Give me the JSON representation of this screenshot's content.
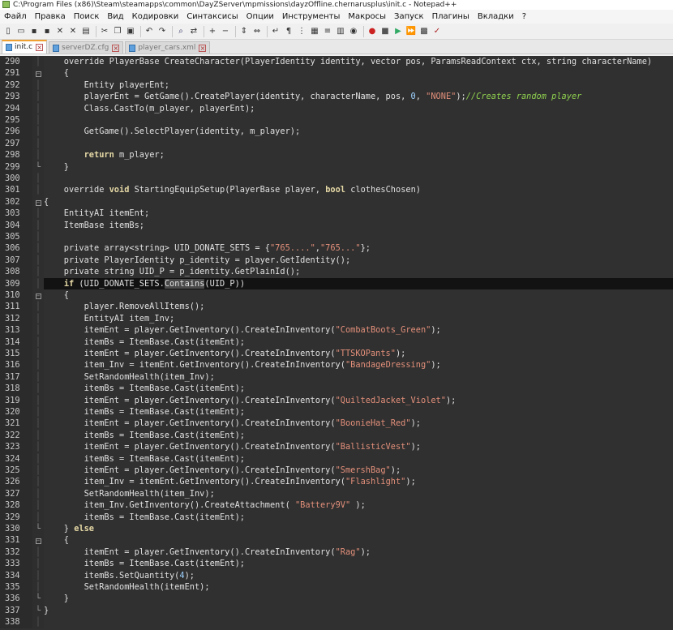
{
  "window": {
    "title": "C:\\Program Files (x86)\\Steam\\steamapps\\common\\DayZServer\\mpmissions\\dayzOffline.chernarusplus\\init.c - Notepad++"
  },
  "menu": [
    "Файл",
    "Правка",
    "Поиск",
    "Вид",
    "Кодировки",
    "Синтаксисы",
    "Опции",
    "Инструменты",
    "Макросы",
    "Запуск",
    "Плагины",
    "Вкладки",
    "?"
  ],
  "toolbar": {
    "icons": [
      "new-file-icon",
      "open-file-icon",
      "save-icon",
      "save-all-icon",
      "close-icon",
      "close-all-icon",
      "print-icon",
      "cut-icon",
      "copy-icon",
      "paste-icon",
      "undo-icon",
      "redo-icon",
      "find-icon",
      "replace-icon",
      "zoom-in-icon",
      "zoom-out-icon",
      "sync-v-icon",
      "sync-h-icon",
      "word-wrap-icon",
      "show-all-chars-icon",
      "indent-guide-icon",
      "doc-map-icon",
      "function-list-icon",
      "folder-workspace-icon",
      "monitor-icon",
      "record-macro-icon",
      "stop-macro-icon",
      "play-macro-icon",
      "run-macro-icon",
      "save-macro-icon",
      "spellcheck-icon"
    ]
  },
  "tabs": [
    {
      "label": "init.c",
      "active": true
    },
    {
      "label": "serverDZ.cfg",
      "active": false
    },
    {
      "label": "player_cars.xml",
      "active": false
    }
  ],
  "editor": {
    "current_line": 309,
    "lines": [
      {
        "n": 290,
        "fold": "",
        "tokens": [
          [
            "t",
            "    override PlayerBase CreateCharacter(PlayerIdentity identity, vector pos, ParamsReadContext ctx, string characterName)"
          ]
        ]
      },
      {
        "n": 291,
        "fold": "box",
        "tokens": [
          [
            "t",
            "    {"
          ]
        ]
      },
      {
        "n": 292,
        "fold": "",
        "tokens": [
          [
            "t",
            "        Entity playerEnt;"
          ]
        ]
      },
      {
        "n": 293,
        "fold": "",
        "tokens": [
          [
            "t",
            "        playerEnt = GetGame().CreatePlayer(identity, characterName, pos, "
          ],
          [
            "n",
            "0"
          ],
          [
            "t",
            ", "
          ],
          [
            "s",
            "\"NONE\""
          ],
          [
            "t",
            ");"
          ],
          [
            "c",
            "//Creates random player"
          ]
        ]
      },
      {
        "n": 294,
        "fold": "",
        "tokens": [
          [
            "t",
            "        Class.CastTo(m_player, playerEnt);"
          ]
        ]
      },
      {
        "n": 295,
        "fold": "",
        "tokens": [
          [
            "t",
            ""
          ]
        ]
      },
      {
        "n": 296,
        "fold": "",
        "tokens": [
          [
            "t",
            "        GetGame().SelectPlayer(identity, m_player);"
          ]
        ]
      },
      {
        "n": 297,
        "fold": "",
        "tokens": [
          [
            "t",
            ""
          ]
        ]
      },
      {
        "n": 298,
        "fold": "",
        "tokens": [
          [
            "t",
            "        "
          ],
          [
            "k",
            "return"
          ],
          [
            "t",
            " m_player;"
          ]
        ]
      },
      {
        "n": 299,
        "fold": "end",
        "tokens": [
          [
            "t",
            "    }"
          ]
        ]
      },
      {
        "n": 300,
        "fold": "",
        "tokens": [
          [
            "t",
            ""
          ]
        ]
      },
      {
        "n": 301,
        "fold": "",
        "tokens": [
          [
            "t",
            "    override "
          ],
          [
            "k",
            "void"
          ],
          [
            "t",
            " StartingEquipSetup(PlayerBase player, "
          ],
          [
            "k",
            "bool"
          ],
          [
            "t",
            " clothesChosen)"
          ]
        ]
      },
      {
        "n": 302,
        "fold": "box",
        "tokens": [
          [
            "t",
            "{"
          ]
        ]
      },
      {
        "n": 303,
        "fold": "",
        "tokens": [
          [
            "t",
            "    EntityAI itemEnt;"
          ]
        ]
      },
      {
        "n": 304,
        "fold": "",
        "tokens": [
          [
            "t",
            "    ItemBase itemBs;"
          ]
        ]
      },
      {
        "n": 305,
        "fold": "",
        "tokens": [
          [
            "t",
            ""
          ]
        ]
      },
      {
        "n": 306,
        "fold": "",
        "tokens": [
          [
            "t",
            "    private array<string> UID_DONATE_SETS = {"
          ],
          [
            "s",
            "\"765....\""
          ],
          [
            "t",
            ","
          ],
          [
            "s",
            "\"765...\""
          ],
          [
            "t",
            "};"
          ]
        ]
      },
      {
        "n": 307,
        "fold": "",
        "tokens": [
          [
            "t",
            "    private PlayerIdentity p_identity = player.GetIdentity();"
          ]
        ]
      },
      {
        "n": 308,
        "fold": "",
        "tokens": [
          [
            "t",
            "    private string UID_P = p_identity.GetPlainId();"
          ]
        ]
      },
      {
        "n": 309,
        "fold": "",
        "tokens": [
          [
            "t",
            "    "
          ],
          [
            "k",
            "if"
          ],
          [
            "t",
            " (UID_DONATE_SETS."
          ],
          [
            "m",
            "Contains"
          ],
          [
            "t",
            "(UID_P))"
          ]
        ]
      },
      {
        "n": 310,
        "fold": "box",
        "tokens": [
          [
            "t",
            "    {"
          ]
        ]
      },
      {
        "n": 311,
        "fold": "",
        "tokens": [
          [
            "t",
            "        player.RemoveAllItems();"
          ]
        ]
      },
      {
        "n": 312,
        "fold": "",
        "tokens": [
          [
            "t",
            "        EntityAI item_Inv;"
          ]
        ]
      },
      {
        "n": 313,
        "fold": "",
        "tokens": [
          [
            "t",
            "        itemEnt = player.GetInventory().CreateInInventory("
          ],
          [
            "s",
            "\"CombatBoots_Green\""
          ],
          [
            "t",
            ");"
          ]
        ]
      },
      {
        "n": 314,
        "fold": "",
        "tokens": [
          [
            "t",
            "        itemBs = ItemBase.Cast(itemEnt);"
          ]
        ]
      },
      {
        "n": 315,
        "fold": "",
        "tokens": [
          [
            "t",
            "        itemEnt = player.GetInventory().CreateInInventory("
          ],
          [
            "s",
            "\"TTSKOPants\""
          ],
          [
            "t",
            ");"
          ]
        ]
      },
      {
        "n": 316,
        "fold": "",
        "tokens": [
          [
            "t",
            "        item_Inv = itemEnt.GetInventory().CreateInInventory("
          ],
          [
            "s",
            "\"BandageDressing\""
          ],
          [
            "t",
            ");"
          ]
        ]
      },
      {
        "n": 317,
        "fold": "",
        "tokens": [
          [
            "t",
            "        SetRandomHealth(item_Inv);"
          ]
        ]
      },
      {
        "n": 318,
        "fold": "",
        "tokens": [
          [
            "t",
            "        itemBs = ItemBase.Cast(itemEnt);"
          ]
        ]
      },
      {
        "n": 319,
        "fold": "",
        "tokens": [
          [
            "t",
            "        itemEnt = player.GetInventory().CreateInInventory("
          ],
          [
            "s",
            "\"QuiltedJacket_Violet\""
          ],
          [
            "t",
            ");"
          ]
        ]
      },
      {
        "n": 320,
        "fold": "",
        "tokens": [
          [
            "t",
            "        itemBs = ItemBase.Cast(itemEnt);"
          ]
        ]
      },
      {
        "n": 321,
        "fold": "",
        "tokens": [
          [
            "t",
            "        itemEnt = player.GetInventory().CreateInInventory("
          ],
          [
            "s",
            "\"BoonieHat_Red\""
          ],
          [
            "t",
            ");"
          ]
        ]
      },
      {
        "n": 322,
        "fold": "",
        "tokens": [
          [
            "t",
            "        itemBs = ItemBase.Cast(itemEnt);"
          ]
        ]
      },
      {
        "n": 323,
        "fold": "",
        "tokens": [
          [
            "t",
            "        itemEnt = player.GetInventory().CreateInInventory("
          ],
          [
            "s",
            "\"BallisticVest\""
          ],
          [
            "t",
            ");"
          ]
        ]
      },
      {
        "n": 324,
        "fold": "",
        "tokens": [
          [
            "t",
            "        itemBs = ItemBase.Cast(itemEnt);"
          ]
        ]
      },
      {
        "n": 325,
        "fold": "",
        "tokens": [
          [
            "t",
            "        itemEnt = player.GetInventory().CreateInInventory("
          ],
          [
            "s",
            "\"SmershBag\""
          ],
          [
            "t",
            ");"
          ]
        ]
      },
      {
        "n": 326,
        "fold": "",
        "tokens": [
          [
            "t",
            "        item_Inv = itemEnt.GetInventory().CreateInInventory("
          ],
          [
            "s",
            "\"Flashlight\""
          ],
          [
            "t",
            ");"
          ]
        ]
      },
      {
        "n": 327,
        "fold": "",
        "tokens": [
          [
            "t",
            "        SetRandomHealth(item_Inv);"
          ]
        ]
      },
      {
        "n": 328,
        "fold": "",
        "tokens": [
          [
            "t",
            "        item_Inv.GetInventory().CreateAttachment( "
          ],
          [
            "s",
            "\"Battery9V\""
          ],
          [
            "t",
            " );"
          ]
        ]
      },
      {
        "n": 329,
        "fold": "",
        "tokens": [
          [
            "t",
            "        itemBs = ItemBase.Cast(itemEnt);"
          ]
        ]
      },
      {
        "n": 330,
        "fold": "end",
        "tokens": [
          [
            "t",
            "    } "
          ],
          [
            "k",
            "else"
          ]
        ]
      },
      {
        "n": 331,
        "fold": "box",
        "tokens": [
          [
            "t",
            "    {"
          ]
        ]
      },
      {
        "n": 332,
        "fold": "",
        "tokens": [
          [
            "t",
            "        itemEnt = player.GetInventory().CreateInInventory("
          ],
          [
            "s",
            "\"Rag\""
          ],
          [
            "t",
            ");"
          ]
        ]
      },
      {
        "n": 333,
        "fold": "",
        "tokens": [
          [
            "t",
            "        itemBs = ItemBase.Cast(itemEnt);"
          ]
        ]
      },
      {
        "n": 334,
        "fold": "",
        "tokens": [
          [
            "t",
            "        itemBs.SetQuantity("
          ],
          [
            "n",
            "4"
          ],
          [
            "t",
            ");"
          ]
        ]
      },
      {
        "n": 335,
        "fold": "",
        "tokens": [
          [
            "t",
            "        SetRandomHealth(itemEnt);"
          ]
        ]
      },
      {
        "n": 336,
        "fold": "end",
        "tokens": [
          [
            "t",
            "    }"
          ]
        ]
      },
      {
        "n": 337,
        "fold": "end",
        "tokens": [
          [
            "t",
            "}"
          ]
        ]
      },
      {
        "n": 338,
        "fold": "",
        "tokens": [
          [
            "t",
            ""
          ]
        ]
      }
    ]
  }
}
